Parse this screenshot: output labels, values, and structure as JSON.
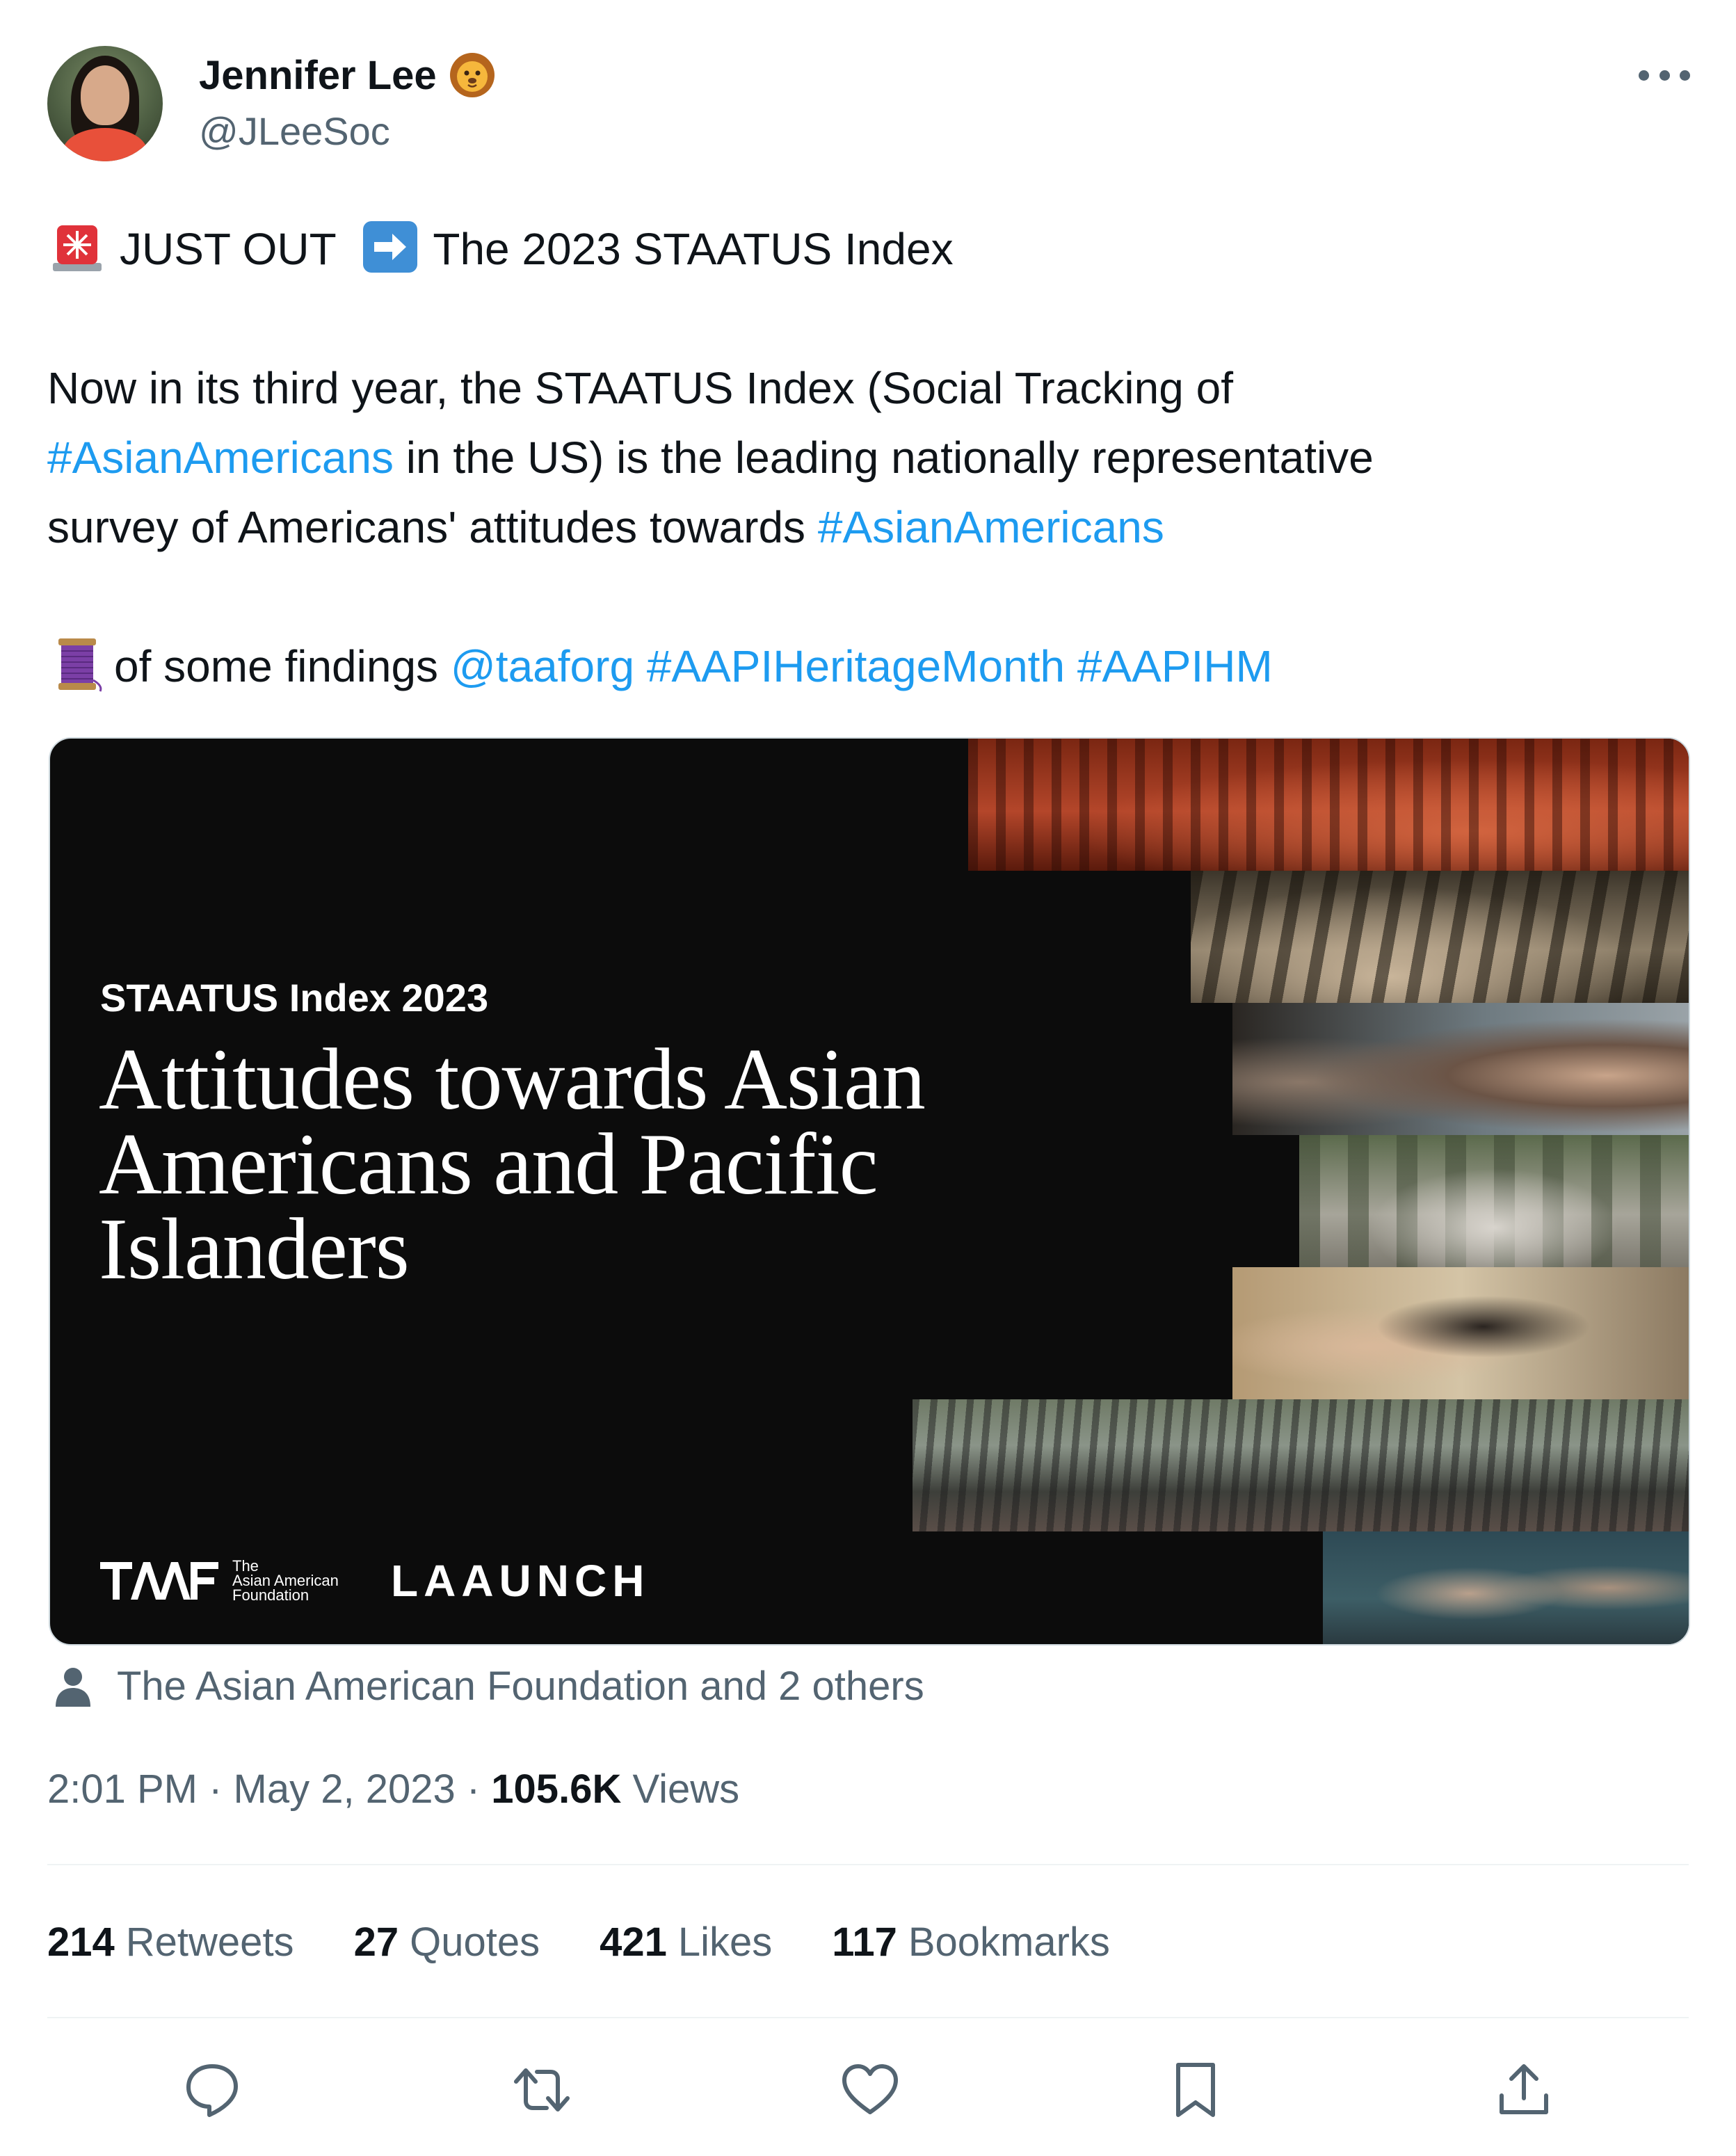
{
  "author": {
    "display_name": "Jennifer Lee",
    "handle": "@JLeeSoc",
    "badge_icon": "lion-face-icon",
    "avatar_icon": "profile-photo"
  },
  "tweet": {
    "line1": {
      "emoji1": "rotating-light-icon",
      "text1": "JUST OUT",
      "emoji2": "right-arrow-icon",
      "text2": "The 2023 STAATUS Index"
    },
    "line2": "Now in its third year, the STAATUS Index (Social Tracking of",
    "line3_link": "#AsianAmericans",
    "line3_text": " in the US) is the leading nationally representative",
    "line4_text": "survey of Americans' attitudes towards ",
    "line4_link": "#AsianAmericans",
    "line5": {
      "emoji": "thread-spool-icon",
      "text": "of some findings ",
      "mention": "@taaforg",
      "hashtag1": "#AAPIHeritageMonth",
      "hashtag2": "#AAPIHM"
    }
  },
  "media": {
    "kicker": "STAATUS Index 2023",
    "headline": "Attitudes towards Asian Americans and Pacific Islanders",
    "logo1_mark": "TAAF",
    "logo1_words": [
      "The",
      "Asian American",
      "Foundation"
    ],
    "logo2": "LAAUNCH"
  },
  "tagged": {
    "icon": "person-icon",
    "text": "The Asian American Foundation and 2 others"
  },
  "meta": {
    "time": "2:01 PM",
    "sep1": " · ",
    "date": "May 2, 2023",
    "sep2": " · ",
    "views_count": "105.6K",
    "views_label": " Views"
  },
  "stats": [
    {
      "count": "214",
      "label": "Retweets"
    },
    {
      "count": "27",
      "label": "Quotes"
    },
    {
      "count": "421",
      "label": "Likes"
    },
    {
      "count": "117",
      "label": "Bookmarks"
    }
  ],
  "actions": [
    "reply-icon",
    "retweet-icon",
    "like-icon",
    "bookmark-icon",
    "share-icon"
  ],
  "colors": {
    "link": "#1d9bf0",
    "secondary_text": "#536471",
    "primary_text": "#0f1419",
    "media_bg": "#0c0c0c"
  }
}
